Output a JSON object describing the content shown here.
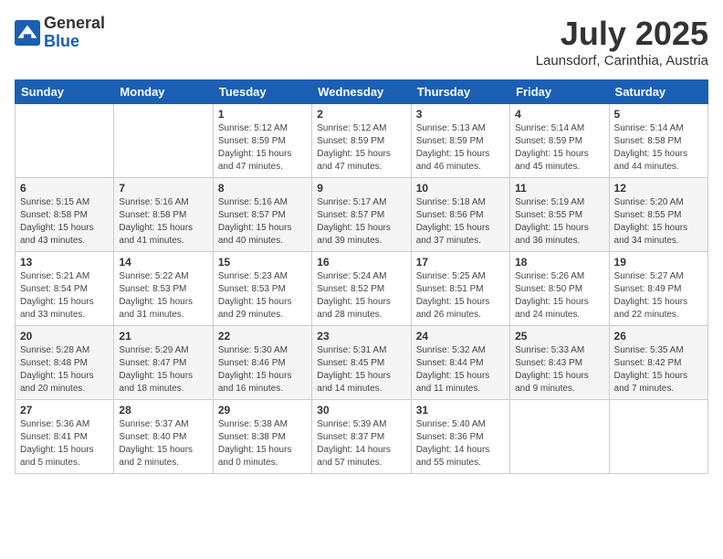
{
  "header": {
    "logo": {
      "general": "General",
      "blue": "Blue"
    },
    "month": "July 2025",
    "location": "Launsdorf, Carinthia, Austria"
  },
  "days_of_week": [
    "Sunday",
    "Monday",
    "Tuesday",
    "Wednesday",
    "Thursday",
    "Friday",
    "Saturday"
  ],
  "weeks": [
    [
      {
        "day": "",
        "sunrise": "",
        "sunset": "",
        "daylight": ""
      },
      {
        "day": "",
        "sunrise": "",
        "sunset": "",
        "daylight": ""
      },
      {
        "day": "1",
        "sunrise": "Sunrise: 5:12 AM",
        "sunset": "Sunset: 8:59 PM",
        "daylight": "Daylight: 15 hours and 47 minutes."
      },
      {
        "day": "2",
        "sunrise": "Sunrise: 5:12 AM",
        "sunset": "Sunset: 8:59 PM",
        "daylight": "Daylight: 15 hours and 47 minutes."
      },
      {
        "day": "3",
        "sunrise": "Sunrise: 5:13 AM",
        "sunset": "Sunset: 8:59 PM",
        "daylight": "Daylight: 15 hours and 46 minutes."
      },
      {
        "day": "4",
        "sunrise": "Sunrise: 5:14 AM",
        "sunset": "Sunset: 8:59 PM",
        "daylight": "Daylight: 15 hours and 45 minutes."
      },
      {
        "day": "5",
        "sunrise": "Sunrise: 5:14 AM",
        "sunset": "Sunset: 8:58 PM",
        "daylight": "Daylight: 15 hours and 44 minutes."
      }
    ],
    [
      {
        "day": "6",
        "sunrise": "Sunrise: 5:15 AM",
        "sunset": "Sunset: 8:58 PM",
        "daylight": "Daylight: 15 hours and 43 minutes."
      },
      {
        "day": "7",
        "sunrise": "Sunrise: 5:16 AM",
        "sunset": "Sunset: 8:58 PM",
        "daylight": "Daylight: 15 hours and 41 minutes."
      },
      {
        "day": "8",
        "sunrise": "Sunrise: 5:16 AM",
        "sunset": "Sunset: 8:57 PM",
        "daylight": "Daylight: 15 hours and 40 minutes."
      },
      {
        "day": "9",
        "sunrise": "Sunrise: 5:17 AM",
        "sunset": "Sunset: 8:57 PM",
        "daylight": "Daylight: 15 hours and 39 minutes."
      },
      {
        "day": "10",
        "sunrise": "Sunrise: 5:18 AM",
        "sunset": "Sunset: 8:56 PM",
        "daylight": "Daylight: 15 hours and 37 minutes."
      },
      {
        "day": "11",
        "sunrise": "Sunrise: 5:19 AM",
        "sunset": "Sunset: 8:55 PM",
        "daylight": "Daylight: 15 hours and 36 minutes."
      },
      {
        "day": "12",
        "sunrise": "Sunrise: 5:20 AM",
        "sunset": "Sunset: 8:55 PM",
        "daylight": "Daylight: 15 hours and 34 minutes."
      }
    ],
    [
      {
        "day": "13",
        "sunrise": "Sunrise: 5:21 AM",
        "sunset": "Sunset: 8:54 PM",
        "daylight": "Daylight: 15 hours and 33 minutes."
      },
      {
        "day": "14",
        "sunrise": "Sunrise: 5:22 AM",
        "sunset": "Sunset: 8:53 PM",
        "daylight": "Daylight: 15 hours and 31 minutes."
      },
      {
        "day": "15",
        "sunrise": "Sunrise: 5:23 AM",
        "sunset": "Sunset: 8:53 PM",
        "daylight": "Daylight: 15 hours and 29 minutes."
      },
      {
        "day": "16",
        "sunrise": "Sunrise: 5:24 AM",
        "sunset": "Sunset: 8:52 PM",
        "daylight": "Daylight: 15 hours and 28 minutes."
      },
      {
        "day": "17",
        "sunrise": "Sunrise: 5:25 AM",
        "sunset": "Sunset: 8:51 PM",
        "daylight": "Daylight: 15 hours and 26 minutes."
      },
      {
        "day": "18",
        "sunrise": "Sunrise: 5:26 AM",
        "sunset": "Sunset: 8:50 PM",
        "daylight": "Daylight: 15 hours and 24 minutes."
      },
      {
        "day": "19",
        "sunrise": "Sunrise: 5:27 AM",
        "sunset": "Sunset: 8:49 PM",
        "daylight": "Daylight: 15 hours and 22 minutes."
      }
    ],
    [
      {
        "day": "20",
        "sunrise": "Sunrise: 5:28 AM",
        "sunset": "Sunset: 8:48 PM",
        "daylight": "Daylight: 15 hours and 20 minutes."
      },
      {
        "day": "21",
        "sunrise": "Sunrise: 5:29 AM",
        "sunset": "Sunset: 8:47 PM",
        "daylight": "Daylight: 15 hours and 18 minutes."
      },
      {
        "day": "22",
        "sunrise": "Sunrise: 5:30 AM",
        "sunset": "Sunset: 8:46 PM",
        "daylight": "Daylight: 15 hours and 16 minutes."
      },
      {
        "day": "23",
        "sunrise": "Sunrise: 5:31 AM",
        "sunset": "Sunset: 8:45 PM",
        "daylight": "Daylight: 15 hours and 14 minutes."
      },
      {
        "day": "24",
        "sunrise": "Sunrise: 5:32 AM",
        "sunset": "Sunset: 8:44 PM",
        "daylight": "Daylight: 15 hours and 11 minutes."
      },
      {
        "day": "25",
        "sunrise": "Sunrise: 5:33 AM",
        "sunset": "Sunset: 8:43 PM",
        "daylight": "Daylight: 15 hours and 9 minutes."
      },
      {
        "day": "26",
        "sunrise": "Sunrise: 5:35 AM",
        "sunset": "Sunset: 8:42 PM",
        "daylight": "Daylight: 15 hours and 7 minutes."
      }
    ],
    [
      {
        "day": "27",
        "sunrise": "Sunrise: 5:36 AM",
        "sunset": "Sunset: 8:41 PM",
        "daylight": "Daylight: 15 hours and 5 minutes."
      },
      {
        "day": "28",
        "sunrise": "Sunrise: 5:37 AM",
        "sunset": "Sunset: 8:40 PM",
        "daylight": "Daylight: 15 hours and 2 minutes."
      },
      {
        "day": "29",
        "sunrise": "Sunrise: 5:38 AM",
        "sunset": "Sunset: 8:38 PM",
        "daylight": "Daylight: 15 hours and 0 minutes."
      },
      {
        "day": "30",
        "sunrise": "Sunrise: 5:39 AM",
        "sunset": "Sunset: 8:37 PM",
        "daylight": "Daylight: 14 hours and 57 minutes."
      },
      {
        "day": "31",
        "sunrise": "Sunrise: 5:40 AM",
        "sunset": "Sunset: 8:36 PM",
        "daylight": "Daylight: 14 hours and 55 minutes."
      },
      {
        "day": "",
        "sunrise": "",
        "sunset": "",
        "daylight": ""
      },
      {
        "day": "",
        "sunrise": "",
        "sunset": "",
        "daylight": ""
      }
    ]
  ]
}
